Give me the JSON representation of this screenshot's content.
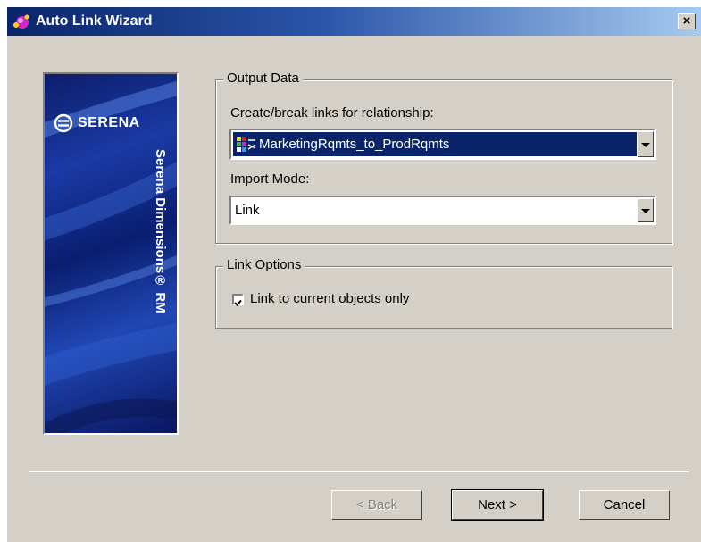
{
  "window": {
    "title": "Auto Link Wizard",
    "close_label": "×",
    "app_icon": "wizard-icon"
  },
  "banner": {
    "logo_text": "SERENA",
    "product_text": "Serena Dimensions® RM",
    "logo_icon": "serena-logo-icon"
  },
  "output_data": {
    "legend": "Output Data",
    "relationship_label": "Create/break links for relationship:",
    "relationship_value": "MarketingRqmts_to_ProdRqmts",
    "relationship_icon": "relationship-icon",
    "import_mode_label": "Import Mode:",
    "import_mode_value": "Link"
  },
  "link_options": {
    "legend": "Link Options",
    "current_only_label": "Link to current objects only",
    "current_only_checked": true
  },
  "buttons": {
    "back_label": "< Back",
    "next_label": "Next >",
    "cancel_label": "Cancel"
  },
  "colors": {
    "titlebar_start": "#0a246a",
    "dialog_face": "#d4d0c8",
    "selection": "#0a246a"
  }
}
